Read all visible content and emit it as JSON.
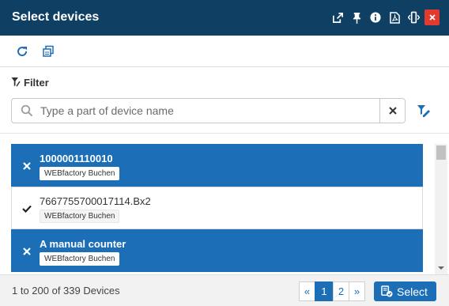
{
  "window": {
    "title": "Select devices",
    "header_icons": [
      "pop-out-icon",
      "pin-icon",
      "info-icon",
      "pdf-icon",
      "resize-icon",
      "close-icon"
    ],
    "colors": {
      "header": "#0f3f63",
      "close": "#e23a2e",
      "accent": "#1c6fb7"
    }
  },
  "toolbar": {
    "buttons": [
      "refresh-icon",
      "copy-icon"
    ]
  },
  "filter": {
    "label": "Filter",
    "search_placeholder": "Type a part of device name",
    "search_value": ""
  },
  "devices": [
    {
      "name": "1000001110010",
      "tag": "WEBfactory Buchen",
      "selected": true,
      "mark": "x-icon"
    },
    {
      "name": "7667755700017114.Bx2",
      "tag": "WEBfactory Buchen",
      "selected": false,
      "mark": "check-icon"
    },
    {
      "name": "A manual counter",
      "tag": "WEBfactory Buchen",
      "selected": true,
      "mark": "x-icon"
    }
  ],
  "footer": {
    "count_text": "1 to 200 of 339 Devices",
    "pages": [
      "«",
      "1",
      "2",
      "»"
    ],
    "active_page": "1",
    "select_label": "Select"
  }
}
